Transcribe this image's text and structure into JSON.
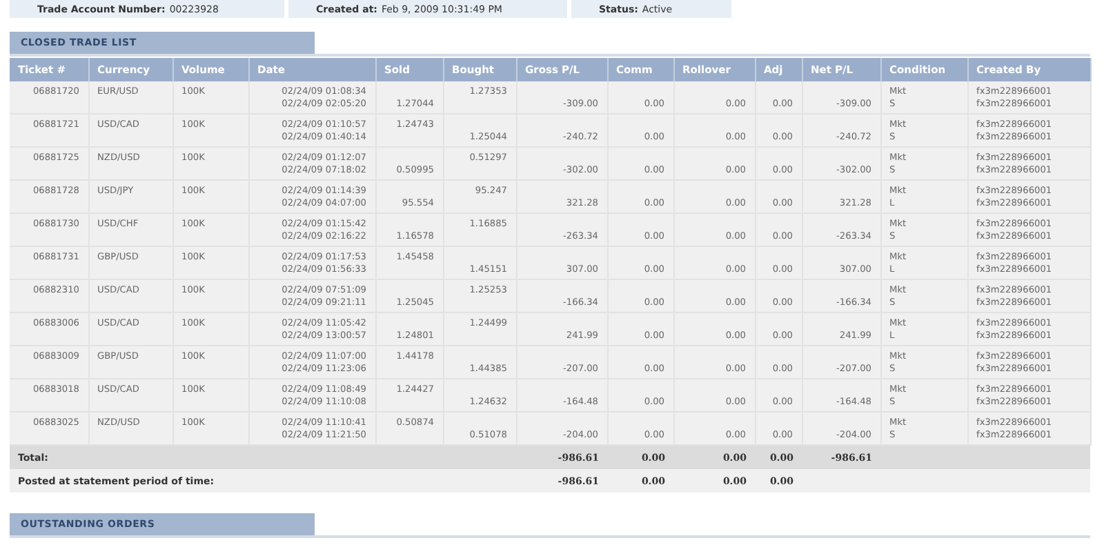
{
  "account_info": [
    {
      "label": "Trade Account Number:",
      "value": "00223928"
    },
    {
      "label": "Created at:",
      "value": "Feb 9, 2009 10:31:49 PM"
    },
    {
      "label": "Status:",
      "value": "Active"
    }
  ],
  "closed_trade_list": {
    "title": "CLOSED TRADE LIST",
    "columns": [
      "Ticket #",
      "Currency",
      "Volume",
      "Date",
      "Sold",
      "Bought",
      "Gross P/L",
      "Comm",
      "Rollover",
      "Adj",
      "Net P/L",
      "Condition",
      "Created By"
    ],
    "rows": [
      {
        "ticket": "06881720",
        "currency": "EUR/USD",
        "volume": "100K",
        "open_date": "02/24/09 01:08:34",
        "close_date": "02/24/09 02:05:20",
        "sold_first": false,
        "sold": "1.27044",
        "bought": "1.27353",
        "gross": "-309.00",
        "comm": "0.00",
        "rollover": "0.00",
        "adj": "0.00",
        "net": "-309.00",
        "condition": "Mkt",
        "side": "S",
        "created_by": [
          "fx3m228966001",
          "fx3m228966001"
        ]
      },
      {
        "ticket": "06881721",
        "currency": "USD/CAD",
        "volume": "100K",
        "open_date": "02/24/09 01:10:57",
        "close_date": "02/24/09 01:40:14",
        "sold_first": true,
        "sold": "1.24743",
        "bought": "1.25044",
        "gross": "-240.72",
        "comm": "0.00",
        "rollover": "0.00",
        "adj": "0.00",
        "net": "-240.72",
        "condition": "Mkt",
        "side": "S",
        "created_by": [
          "fx3m228966001",
          "fx3m228966001"
        ]
      },
      {
        "ticket": "06881725",
        "currency": "NZD/USD",
        "volume": "100K",
        "open_date": "02/24/09 01:12:07",
        "close_date": "02/24/09 07:18:02",
        "sold_first": false,
        "sold": "0.50995",
        "bought": "0.51297",
        "gross": "-302.00",
        "comm": "0.00",
        "rollover": "0.00",
        "adj": "0.00",
        "net": "-302.00",
        "condition": "Mkt",
        "side": "S",
        "created_by": [
          "fx3m228966001",
          "fx3m228966001"
        ]
      },
      {
        "ticket": "06881728",
        "currency": "USD/JPY",
        "volume": "100K",
        "open_date": "02/24/09 01:14:39",
        "close_date": "02/24/09 04:07:00",
        "sold_first": false,
        "sold": "95.554",
        "bought": "95.247",
        "gross": "321.28",
        "comm": "0.00",
        "rollover": "0.00",
        "adj": "0.00",
        "net": "321.28",
        "condition": "Mkt",
        "side": "L",
        "created_by": [
          "fx3m228966001",
          "fx3m228966001"
        ]
      },
      {
        "ticket": "06881730",
        "currency": "USD/CHF",
        "volume": "100K",
        "open_date": "02/24/09 01:15:42",
        "close_date": "02/24/09 02:16:22",
        "sold_first": false,
        "sold": "1.16578",
        "bought": "1.16885",
        "gross": "-263.34",
        "comm": "0.00",
        "rollover": "0.00",
        "adj": "0.00",
        "net": "-263.34",
        "condition": "Mkt",
        "side": "S",
        "created_by": [
          "fx3m228966001",
          "fx3m228966001"
        ]
      },
      {
        "ticket": "06881731",
        "currency": "GBP/USD",
        "volume": "100K",
        "open_date": "02/24/09 01:17:53",
        "close_date": "02/24/09 01:56:33",
        "sold_first": true,
        "sold": "1.45458",
        "bought": "1.45151",
        "gross": "307.00",
        "comm": "0.00",
        "rollover": "0.00",
        "adj": "0.00",
        "net": "307.00",
        "condition": "Mkt",
        "side": "L",
        "created_by": [
          "fx3m228966001",
          "fx3m228966001"
        ]
      },
      {
        "ticket": "06882310",
        "currency": "USD/CAD",
        "volume": "100K",
        "open_date": "02/24/09 07:51:09",
        "close_date": "02/24/09 09:21:11",
        "sold_first": false,
        "sold": "1.25045",
        "bought": "1.25253",
        "gross": "-166.34",
        "comm": "0.00",
        "rollover": "0.00",
        "adj": "0.00",
        "net": "-166.34",
        "condition": "Mkt",
        "side": "S",
        "created_by": [
          "fx3m228966001",
          "fx3m228966001"
        ]
      },
      {
        "ticket": "06883006",
        "currency": "USD/CAD",
        "volume": "100K",
        "open_date": "02/24/09 11:05:42",
        "close_date": "02/24/09 13:00:57",
        "sold_first": false,
        "sold": "1.24801",
        "bought": "1.24499",
        "gross": "241.99",
        "comm": "0.00",
        "rollover": "0.00",
        "adj": "0.00",
        "net": "241.99",
        "condition": "Mkt",
        "side": "L",
        "created_by": [
          "fx3m228966001",
          "fx3m228966001"
        ]
      },
      {
        "ticket": "06883009",
        "currency": "GBP/USD",
        "volume": "100K",
        "open_date": "02/24/09 11:07:00",
        "close_date": "02/24/09 11:23:06",
        "sold_first": true,
        "sold": "1.44178",
        "bought": "1.44385",
        "gross": "-207.00",
        "comm": "0.00",
        "rollover": "0.00",
        "adj": "0.00",
        "net": "-207.00",
        "condition": "Mkt",
        "side": "S",
        "created_by": [
          "fx3m228966001",
          "fx3m228966001"
        ]
      },
      {
        "ticket": "06883018",
        "currency": "USD/CAD",
        "volume": "100K",
        "open_date": "02/24/09 11:08:49",
        "close_date": "02/24/09 11:10:08",
        "sold_first": true,
        "sold": "1.24427",
        "bought": "1.24632",
        "gross": "-164.48",
        "comm": "0.00",
        "rollover": "0.00",
        "adj": "0.00",
        "net": "-164.48",
        "condition": "Mkt",
        "side": "S",
        "created_by": [
          "fx3m228966001",
          "fx3m228966001"
        ]
      },
      {
        "ticket": "06883025",
        "currency": "NZD/USD",
        "volume": "100K",
        "open_date": "02/24/09 11:10:41",
        "close_date": "02/24/09 11:21:50",
        "sold_first": true,
        "sold": "0.50874",
        "bought": "0.51078",
        "gross": "-204.00",
        "comm": "0.00",
        "rollover": "0.00",
        "adj": "0.00",
        "net": "-204.00",
        "condition": "Mkt",
        "side": "S",
        "created_by": [
          "fx3m228966001",
          "fx3m228966001"
        ]
      }
    ],
    "summary_rows": [
      {
        "kind": "total",
        "label": "Total:",
        "gross": "-986.61",
        "comm": "0.00",
        "rollover": "0.00",
        "adj": "0.00",
        "net": "-986.61"
      },
      {
        "kind": "posted",
        "label": "Posted at statement period of time:",
        "gross": "-986.61",
        "comm": "0.00",
        "rollover": "0.00",
        "adj": "0.00"
      }
    ]
  },
  "outstanding_orders": {
    "title": "OUTSTANDING ORDERS"
  }
}
